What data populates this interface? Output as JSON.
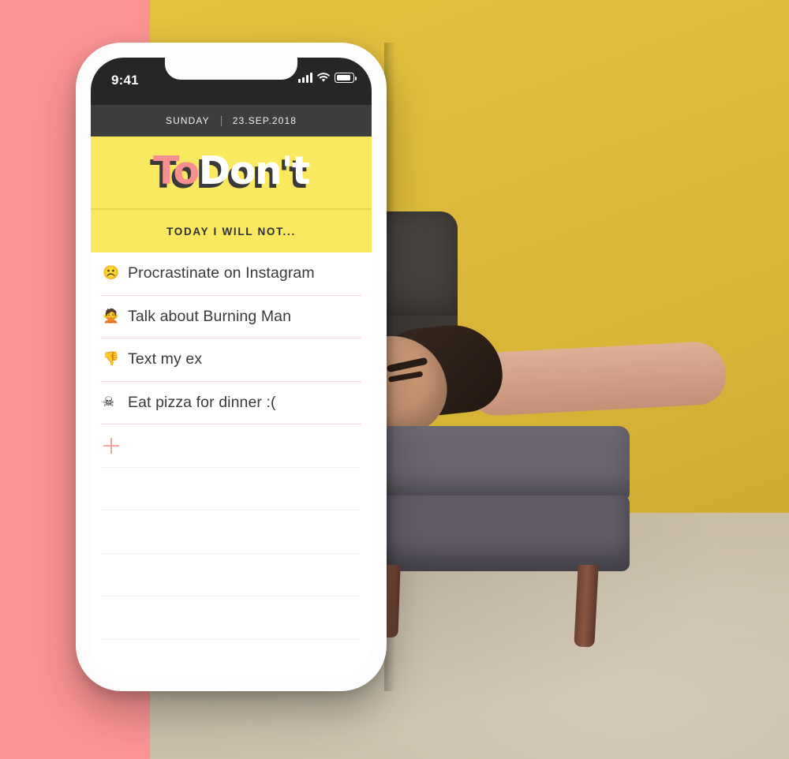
{
  "background": {
    "left_panel_color": "#fc9494",
    "photo_description": "man-sleeping-on-sofa-photo",
    "wall_color": "#ddbc3c",
    "floor_color": "#cbc0a9",
    "sofa_color": "#47443f"
  },
  "phone": {
    "status_bar": {
      "time": "9:41",
      "signal_icon": "signal-bars-icon",
      "wifi_icon": "wifi-icon",
      "battery_icon": "battery-icon"
    },
    "date_bar": {
      "weekday": "SUNDAY",
      "date": "23.SEP.2018"
    },
    "logo": {
      "part_one": "To",
      "part_two": "Don't",
      "part_one_color": "#f58f90",
      "part_two_color": "#ffffff",
      "shadow_color": "#3a3a3a",
      "background_color": "#fae95f"
    },
    "subtitle": "TODAY I WILL NOT...",
    "list": {
      "items": [
        {
          "emoji": "☹️",
          "emoji_name": "frowning-face-emoji",
          "text": "Procrastinate on Instagram"
        },
        {
          "emoji": "🙅",
          "emoji_name": "person-gesturing-no-emoji",
          "text": "Talk about Burning Man"
        },
        {
          "emoji": "👎",
          "emoji_name": "thumbs-down-emoji",
          "text": "Text my ex"
        },
        {
          "emoji": "☠",
          "emoji_name": "skull-and-crossbones-emoji",
          "text": "Eat pizza for dinner :("
        }
      ],
      "add_row": {
        "icon_name": "plus-icon",
        "icon_color": "#f9a1a1"
      },
      "empty_rows": 5,
      "divider_color": "#fbd9da",
      "empty_divider_color": "#f3f3f3"
    }
  }
}
